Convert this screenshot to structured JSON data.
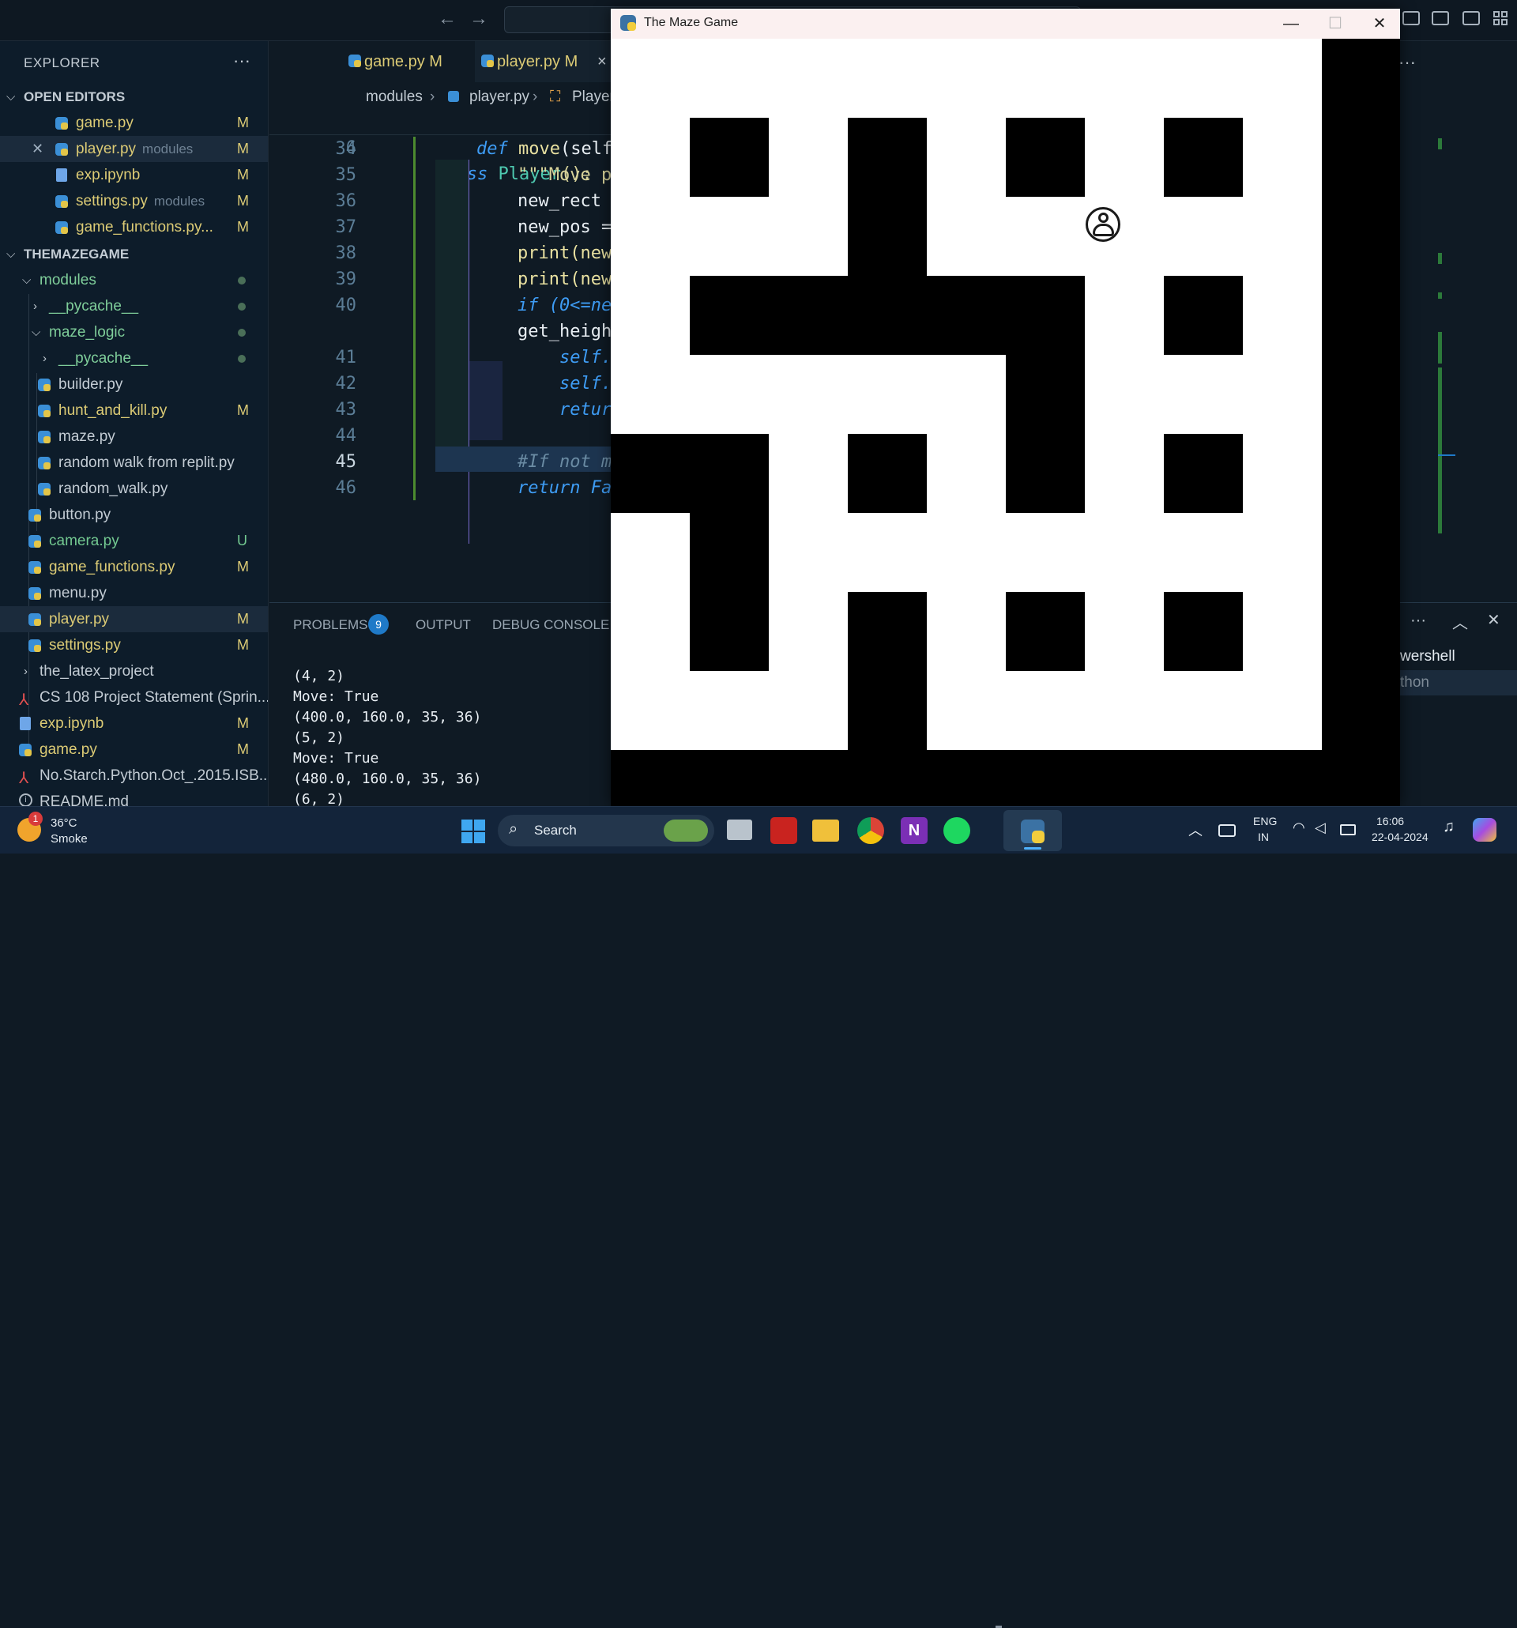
{
  "explorer": {
    "title": "EXPLORER",
    "more": "···",
    "open_editors_header": "OPEN EDITORS",
    "open_editors": [
      {
        "name": "game.py",
        "desc": "",
        "badge": "M"
      },
      {
        "name": "player.py",
        "desc": "modules",
        "badge": "M"
      },
      {
        "name": "exp.ipynb",
        "desc": "",
        "badge": "M"
      },
      {
        "name": "settings.py",
        "desc": "modules",
        "badge": "M"
      },
      {
        "name": "game_functions.py...",
        "desc": "",
        "badge": "M"
      }
    ],
    "project_header": "THEMAZEGAME",
    "tree": [
      {
        "name": "modules"
      },
      {
        "name": "__pycache__"
      },
      {
        "name": "maze_logic"
      },
      {
        "name": "__pycache__"
      },
      {
        "name": "builder.py",
        "badge": ""
      },
      {
        "name": "hunt_and_kill.py",
        "badge": "M"
      },
      {
        "name": "maze.py",
        "badge": ""
      },
      {
        "name": "random walk from replit.py",
        "badge": ""
      },
      {
        "name": "random_walk.py",
        "badge": ""
      },
      {
        "name": "button.py",
        "badge": ""
      },
      {
        "name": "camera.py",
        "badge": "U"
      },
      {
        "name": "game_functions.py",
        "badge": "M"
      },
      {
        "name": "menu.py",
        "badge": ""
      },
      {
        "name": "player.py",
        "badge": "M"
      },
      {
        "name": "settings.py",
        "badge": "M"
      },
      {
        "name": "the_latex_project",
        "badge": ""
      },
      {
        "name": "CS 108 Project Statement (Sprin...",
        "badge": ""
      },
      {
        "name": "exp.ipynb",
        "badge": "M"
      },
      {
        "name": "game.py",
        "badge": "M"
      },
      {
        "name": "No.Starch.Python.Oct_.2015.ISB...",
        "badge": ""
      },
      {
        "name": "README.md",
        "badge": ""
      }
    ]
  },
  "editor": {
    "tabs": [
      {
        "name": "game.py",
        "badge": "M"
      },
      {
        "name": "player.py",
        "badge": "M"
      }
    ],
    "tab_close": "×",
    "breadcrumb": {
      "folder": "modules",
      "file": "player.py",
      "symbol": "Player"
    },
    "lines": [
      {
        "no": "6",
        "text": "class Player():"
      },
      {
        "no": "34",
        "text": "def move(self"
      },
      {
        "no": "35",
        "text": "\"\"\"Move p"
      },
      {
        "no": "36",
        "text": "new_rect"
      },
      {
        "no": "37",
        "text": "new_pos ="
      },
      {
        "no": "38",
        "text": "print(new"
      },
      {
        "no": "39",
        "text": "print(new"
      },
      {
        "no": "40",
        "text": "if (0<=ne"
      },
      {
        "no": "",
        "text": "get_heigh"
      },
      {
        "no": "41",
        "text": "self."
      },
      {
        "no": "42",
        "text": "self."
      },
      {
        "no": "43",
        "text": "retur"
      },
      {
        "no": "44",
        "text": ""
      },
      {
        "no": "45",
        "text": "#If not m"
      },
      {
        "no": "46",
        "text": "return Fa"
      }
    ]
  },
  "panel": {
    "tabs": [
      "PROBLEMS",
      "OUTPUT",
      "DEBUG CONSOLE"
    ],
    "problems_count": "9",
    "terminal_lines": [
      "(4, 2)",
      "Move: True",
      "(400.0, 160.0, 35, 36)",
      "(5, 2)",
      "Move: True",
      "(480.0, 160.0, 35, 36)",
      "(6, 2)"
    ],
    "right_items": [
      "wershell",
      "thon"
    ]
  },
  "maze_window": {
    "title": "The Maze Game",
    "minimize": "—",
    "maximize": "☐",
    "close": "✕"
  },
  "taskbar": {
    "weather_temp": "36°C",
    "weather_desc": "Smoke",
    "weather_badge": "1",
    "search_label": "Search",
    "lang_top": "ENG",
    "lang_bottom": "IN",
    "time": "16:06",
    "date": "22-04-2024"
  },
  "colors": {
    "accent": "#1f7ac8",
    "modified": "#dccb75",
    "untracked": "#73c991"
  }
}
